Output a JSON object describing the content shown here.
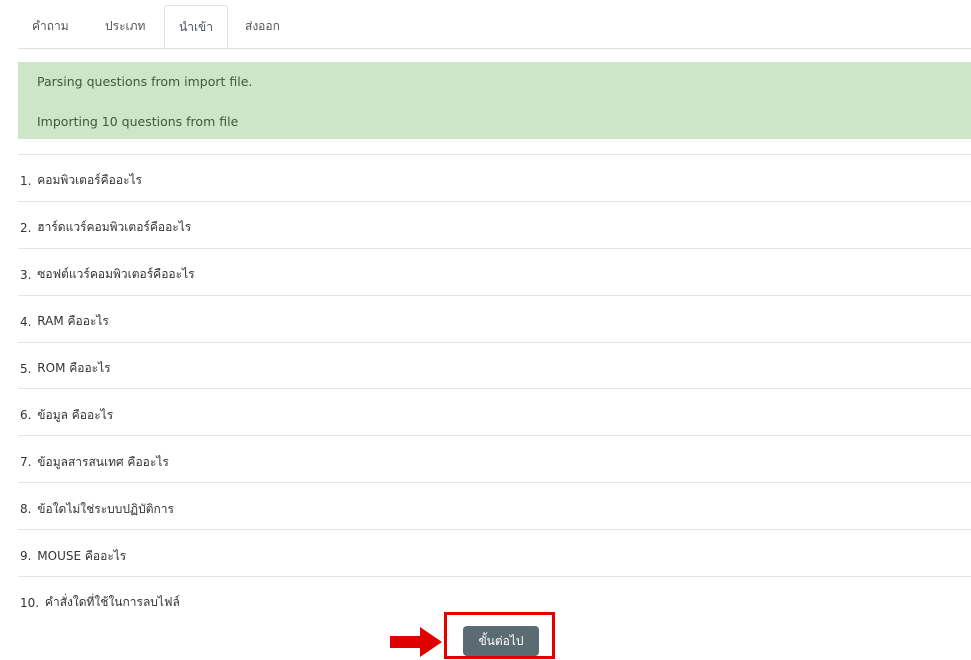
{
  "tabs": [
    {
      "label": "คำถาม"
    },
    {
      "label": "ประเภท"
    },
    {
      "label": "นำเข้า"
    },
    {
      "label": "ส่งออก"
    }
  ],
  "active_tab": "นำเข้า",
  "notice": {
    "line1": "Parsing questions from import file.",
    "line2": "Importing 10 questions from file"
  },
  "questions": [
    {
      "num": "1.",
      "text": "คอมพิวเตอร์คืออะไร"
    },
    {
      "num": "2.",
      "text": "ฮาร์ดแวร์คอมพิวเตอร์คืออะไร"
    },
    {
      "num": "3.",
      "text": "ซอฟต์แวร์คอมพิวเตอร์คืออะไร"
    },
    {
      "num": "4.",
      "text": "RAM คืออะไร"
    },
    {
      "num": "5.",
      "text": "ROM คืออะไร"
    },
    {
      "num": "6.",
      "text": "ข้อมูล คืออะไร"
    },
    {
      "num": "7.",
      "text": "ข้อมูลสารสนเทศ คืออะไร"
    },
    {
      "num": "8.",
      "text": "ข้อใดไม่ใช่ระบบปฏิบัติการ"
    },
    {
      "num": "9.",
      "text": "MOUSE คืออะไร"
    },
    {
      "num": "10.",
      "text": "คำสั่งใดที่ใช้ในการลบไฟล์"
    }
  ],
  "continue_button": {
    "label": "ขั้นต่อไป"
  },
  "colors": {
    "notice_bg": "#cfe5c8",
    "button_bg": "#5a6b72",
    "highlight": "#e00000"
  },
  "icons": {
    "arrow": "arrow-right-icon"
  }
}
